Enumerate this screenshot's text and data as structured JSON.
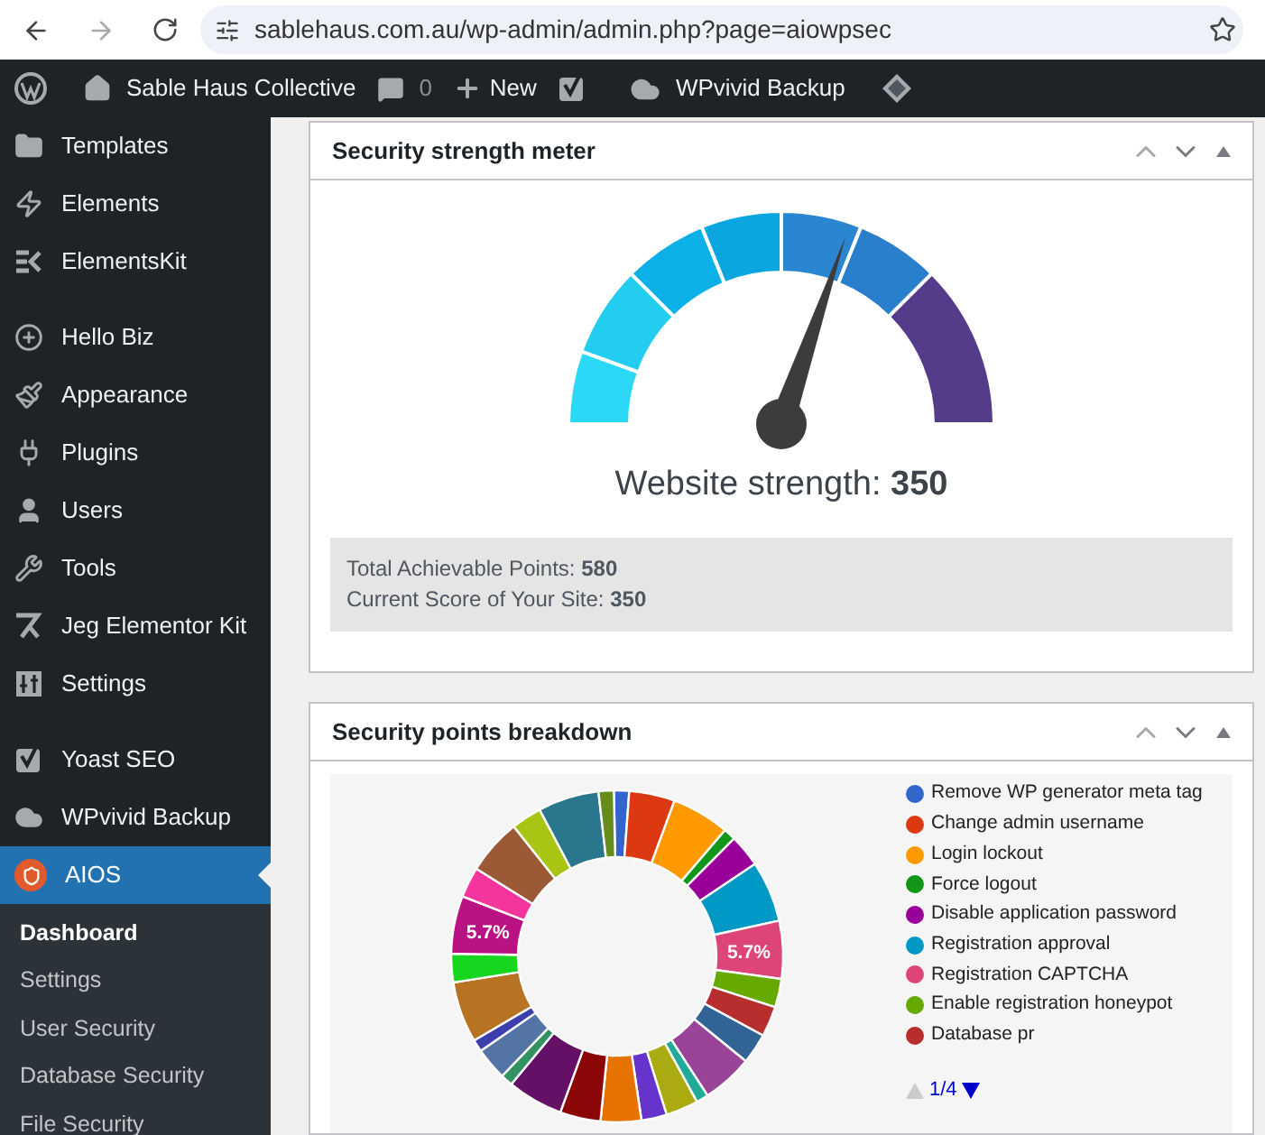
{
  "browser": {
    "url": "sablehaus.com.au/wp-admin/admin.php?page=aiowpsec"
  },
  "admin_bar": {
    "site_name": "Sable Haus Collective",
    "comments_count": "0",
    "new_label": "New",
    "backup_label": "WPvivid Backup"
  },
  "sidebar": {
    "groups": [
      [
        {
          "label": "Templates",
          "selected": false
        },
        {
          "label": "Elements",
          "selected": false
        },
        {
          "label": "ElementsKit",
          "selected": false
        }
      ],
      [
        {
          "label": "Hello Biz",
          "selected": false
        },
        {
          "label": "Appearance",
          "selected": false
        },
        {
          "label": "Plugins",
          "selected": false
        },
        {
          "label": "Users",
          "selected": false
        },
        {
          "label": "Tools",
          "selected": false
        },
        {
          "label": "Jeg Elementor Kit",
          "selected": false
        },
        {
          "label": "Settings",
          "selected": false
        }
      ],
      [
        {
          "label": "Yoast SEO",
          "selected": false
        },
        {
          "label": "WPvivid Backup",
          "selected": false
        },
        {
          "label": "AIOS",
          "selected": true
        }
      ]
    ],
    "submenu": [
      {
        "label": "Dashboard",
        "selected": true
      },
      {
        "label": "Settings",
        "selected": false
      },
      {
        "label": "User Security",
        "selected": false
      },
      {
        "label": "Database Security",
        "selected": false
      },
      {
        "label": "File Security",
        "selected": false
      }
    ]
  },
  "meter_panel": {
    "title": "Security strength meter",
    "strength_label": "Website strength:",
    "strength_value": "350",
    "level": 0.605,
    "total_label": "Total Achievable Points:",
    "total_value": "580",
    "current_label": "Current Score of Your Site:",
    "current_value": "350"
  },
  "breakdown_panel": {
    "title": "Security points breakdown",
    "slice_labels": [
      "5.7%",
      "5.7%"
    ],
    "legend": [
      {
        "label": "Remove WP generator meta tag",
        "color": "#3366cc"
      },
      {
        "label": "Change admin username",
        "color": "#dc3912"
      },
      {
        "label": "Login lockout",
        "color": "#ff9900"
      },
      {
        "label": "Force logout",
        "color": "#109618"
      },
      {
        "label": "Disable application password",
        "color": "#990099"
      },
      {
        "label": "Registration approval",
        "color": "#0099c6"
      },
      {
        "label": "Registration CAPTCHA",
        "color": "#dd4477"
      },
      {
        "label": "Enable registration honeypot",
        "color": "#66aa00"
      },
      {
        "label": "Database pr",
        "color": "#b82e2e"
      }
    ],
    "page": "1/4",
    "prev_disabled": true,
    "next_disabled": false
  }
}
